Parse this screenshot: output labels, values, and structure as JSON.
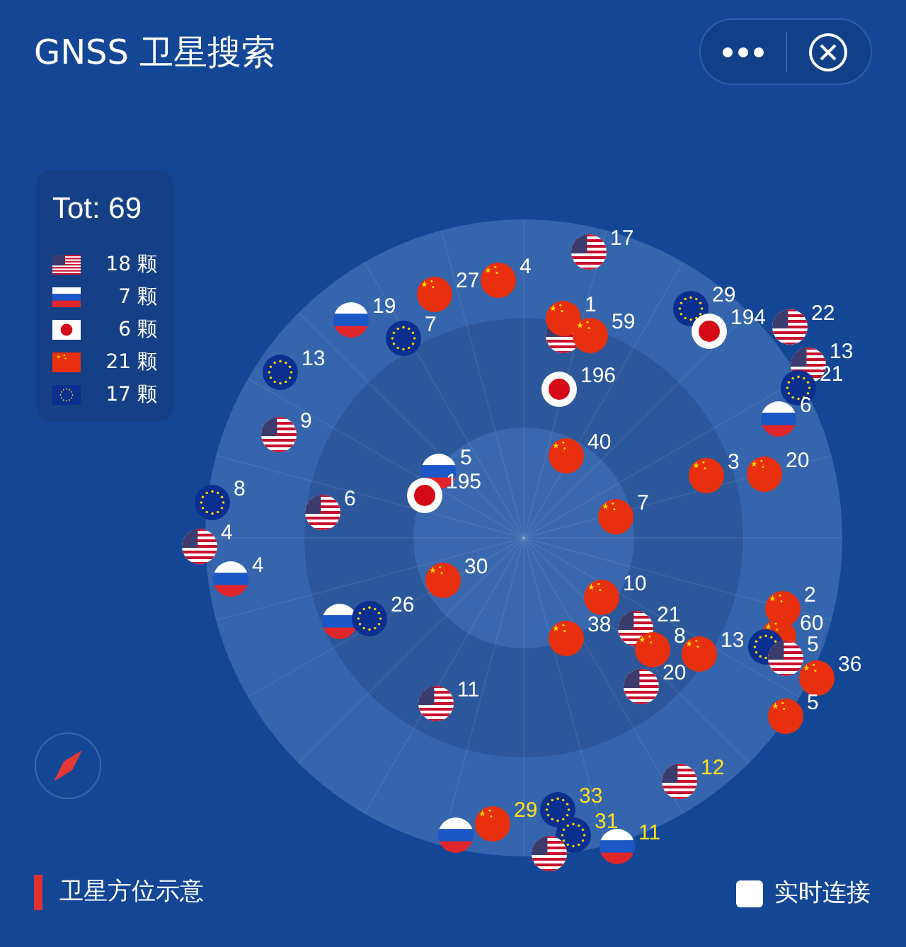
{
  "header": {
    "title": "GNSS 卫星搜索"
  },
  "legend": {
    "total": "Tot: 69",
    "items": [
      {
        "kind": "us",
        "count": "18 颗"
      },
      {
        "kind": "ru",
        "count": "7 颗"
      },
      {
        "kind": "jp",
        "count": "6 颗"
      },
      {
        "kind": "cn",
        "count": "21 颗"
      },
      {
        "kind": "eu",
        "count": "17 颗"
      }
    ]
  },
  "satellites": [
    {
      "kind": "us",
      "label": "17",
      "weak": false
    },
    {
      "kind": "cn",
      "label": "27",
      "weak": false
    },
    {
      "kind": "cn",
      "label": "4",
      "weak": false
    },
    {
      "kind": "ru",
      "label": "19",
      "weak": false
    },
    {
      "kind": "eu",
      "label": "7",
      "weak": false
    },
    {
      "kind": "us"
    },
    {
      "kind": "cn",
      "label": "1",
      "weak": false
    },
    {
      "kind": "cn",
      "label": "59",
      "weak": false
    },
    {
      "kind": "eu",
      "label": "29",
      "weak": false
    },
    {
      "kind": "jp",
      "label": "194",
      "weak": false
    },
    {
      "kind": "us",
      "label": "22",
      "weak": false
    },
    {
      "kind": "us",
      "label": "13",
      "weak": false
    },
    {
      "kind": "eu",
      "label": "21",
      "weak": false
    },
    {
      "kind": "ru",
      "label": "6",
      "weak": false
    },
    {
      "kind": "eu",
      "label": "13",
      "weak": false
    },
    {
      "kind": "jp",
      "label": "196",
      "weak": false
    },
    {
      "kind": "us",
      "label": "9",
      "weak": false
    },
    {
      "kind": "ru",
      "label": "5",
      "weak": false
    },
    {
      "kind": "jp",
      "label": "195",
      "weak": false
    },
    {
      "kind": "cn",
      "label": "40",
      "weak": false
    },
    {
      "kind": "cn",
      "label": "3",
      "weak": false
    },
    {
      "kind": "cn",
      "label": "20",
      "weak": false
    },
    {
      "kind": "eu",
      "label": "8",
      "weak": false
    },
    {
      "kind": "us",
      "label": "6",
      "weak": false
    },
    {
      "kind": "cn",
      "label": "7",
      "weak": false
    },
    {
      "kind": "us",
      "label": "4",
      "weak": false
    },
    {
      "kind": "ru",
      "label": "4",
      "weak": false
    },
    {
      "kind": "cn",
      "label": "30",
      "weak": false
    },
    {
      "kind": "cn",
      "label": "10",
      "weak": false
    },
    {
      "kind": "ru"
    },
    {
      "kind": "eu",
      "label": "26",
      "weak": false
    },
    {
      "kind": "cn",
      "label": "38",
      "weak": false
    },
    {
      "kind": "us",
      "label": "21",
      "weak": false
    },
    {
      "kind": "cn",
      "label": "8",
      "weak": false
    },
    {
      "kind": "cn",
      "label": "13",
      "weak": false
    },
    {
      "kind": "cn",
      "label": "2",
      "weak": false
    },
    {
      "kind": "cn",
      "label": "60",
      "weak": false
    },
    {
      "kind": "eu"
    },
    {
      "kind": "us",
      "label": "5",
      "weak": false
    },
    {
      "kind": "cn",
      "label": "36",
      "weak": false
    },
    {
      "kind": "cn",
      "label": "5",
      "weak": false
    },
    {
      "kind": "us",
      "label": "20",
      "weak": false
    },
    {
      "kind": "us",
      "label": "11",
      "weak": false
    },
    {
      "kind": "us",
      "label": "12",
      "weak": true
    },
    {
      "kind": "eu",
      "label": "33",
      "weak": true
    },
    {
      "kind": "ru"
    },
    {
      "kind": "cn",
      "label": "29",
      "weak": true
    },
    {
      "kind": "eu",
      "label": "31",
      "weak": true
    },
    {
      "kind": "us"
    },
    {
      "kind": "ru",
      "label": "11",
      "weak": true
    }
  ],
  "footer": {
    "caption": "卫星方位示意",
    "live": {
      "label": "实时连接",
      "checked": false
    }
  }
}
